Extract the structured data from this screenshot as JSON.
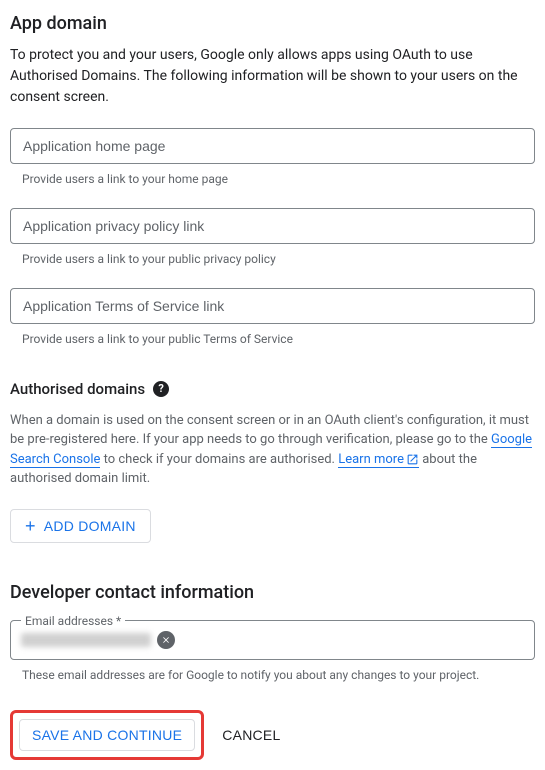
{
  "app_domain": {
    "heading": "App domain",
    "description": "To protect you and your users, Google only allows apps using OAuth to use Authorised Domains. The following information will be shown to your users on the consent screen.",
    "fields": [
      {
        "placeholder": "Application home page",
        "helper": "Provide users a link to your home page"
      },
      {
        "placeholder": "Application privacy policy link",
        "helper": "Provide users a link to your public privacy policy"
      },
      {
        "placeholder": "Application Terms of Service link",
        "helper": "Provide users a link to your public Terms of Service"
      }
    ]
  },
  "authorised": {
    "heading": "Authorised domains",
    "description_pre": "When a domain is used on the consent screen or in an OAuth client's configuration, it must be pre-registered here. If your app needs to go through verification, please go to the ",
    "link1": "Google Search Console",
    "description_mid": " to check if your domains are authorised. ",
    "link2": "Learn more",
    "description_post": " about the authorised domain limit.",
    "add_button": "ADD DOMAIN"
  },
  "developer": {
    "heading": "Developer contact information",
    "email_label": "Email addresses *",
    "email_helper": "These email addresses are for Google to notify you about any changes to your project."
  },
  "buttons": {
    "save": "SAVE AND CONTINUE",
    "cancel": "CANCEL"
  }
}
